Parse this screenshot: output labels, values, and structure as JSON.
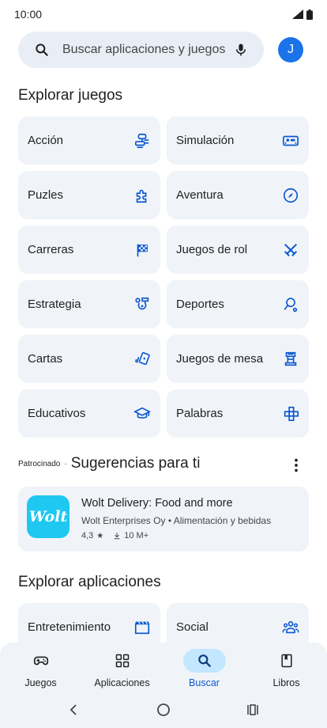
{
  "status": {
    "time": "10:00"
  },
  "search": {
    "placeholder": "Buscar aplicaciones y juegos"
  },
  "profile": {
    "initial": "J"
  },
  "games_section": {
    "title": "Explorar juegos",
    "categories": [
      {
        "label": "Acción",
        "icon": "joystick-icon"
      },
      {
        "label": "Simulación",
        "icon": "vr-headset-icon"
      },
      {
        "label": "Puzles",
        "icon": "puzzle-icon"
      },
      {
        "label": "Aventura",
        "icon": "compass-icon"
      },
      {
        "label": "Carreras",
        "icon": "checkered-flag-icon"
      },
      {
        "label": "Juegos de rol",
        "icon": "crossed-swords-icon"
      },
      {
        "label": "Estrategia",
        "icon": "strategy-icon"
      },
      {
        "label": "Deportes",
        "icon": "sports-icon"
      },
      {
        "label": "Cartas",
        "icon": "cards-icon"
      },
      {
        "label": "Juegos de mesa",
        "icon": "chess-rook-icon"
      },
      {
        "label": "Educativos",
        "icon": "graduation-cap-icon"
      },
      {
        "label": "Palabras",
        "icon": "word-tiles-icon"
      }
    ]
  },
  "suggestions": {
    "sponsored_label": "Patrocinado",
    "separator": "·",
    "title": "Sugerencias para ti",
    "app": {
      "icon_text": "Wolt",
      "name": "Wolt Delivery: Food and more",
      "developer": "Wolt Enterprises Oy",
      "category_sep": "•",
      "category": "Alimentación y bebidas",
      "rating": "4,3",
      "downloads": "10 M+"
    }
  },
  "apps_section": {
    "title": "Explorar aplicaciones",
    "categories": [
      {
        "label": "Entretenimiento",
        "icon": "clapperboard-icon"
      },
      {
        "label": "Social",
        "icon": "group-icon"
      }
    ]
  },
  "bottom_nav": {
    "items": [
      {
        "label": "Juegos",
        "icon": "gamepad-icon",
        "active": false
      },
      {
        "label": "Aplicaciones",
        "icon": "apps-grid-icon",
        "active": false
      },
      {
        "label": "Buscar",
        "icon": "search-icon",
        "active": true
      },
      {
        "label": "Libros",
        "icon": "book-icon",
        "active": false
      }
    ]
  },
  "colors": {
    "accent": "#0b57d0",
    "tile_bg": "#f0f4f9",
    "search_bg": "#e9eef6",
    "active_pill": "#c2e7ff",
    "avatar": "#1a73e8",
    "wolt": "#1ec8f0"
  }
}
